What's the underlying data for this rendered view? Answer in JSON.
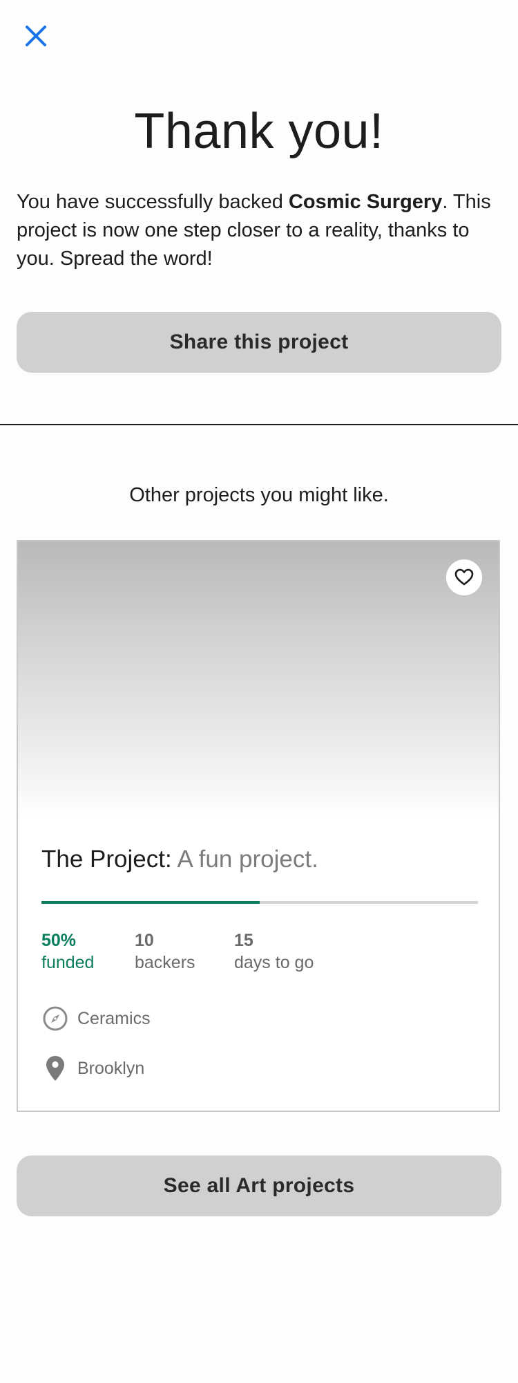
{
  "header": {
    "close_icon": "close-icon"
  },
  "thanks": {
    "title": "Thank you!",
    "message_prefix": "You have successfully backed ",
    "project_name": "Cosmic Surgery",
    "message_suffix": ". This project is now one step closer to a reality, thanks to you. Spread the word!",
    "share_label": "Share this project"
  },
  "recommendations": {
    "heading": "Other projects you might like.",
    "card": {
      "name": "The Project:",
      "blurb": "A fun project.",
      "progress_percent": 50,
      "funded_value": "50%",
      "funded_label": "funded",
      "backers_value": "10",
      "backers_label": "backers",
      "days_value": "15",
      "days_label": "days to go",
      "category": "Ceramics",
      "location": "Brooklyn",
      "heart_icon": "heart-icon",
      "category_icon": "compass-icon",
      "location_icon": "location-pin-icon"
    },
    "see_all_label": "See all Art projects"
  },
  "colors": {
    "accent_blue": "#1a73e8",
    "funded_green": "#0b7f5d",
    "button_gray": "#d0d0d0"
  }
}
